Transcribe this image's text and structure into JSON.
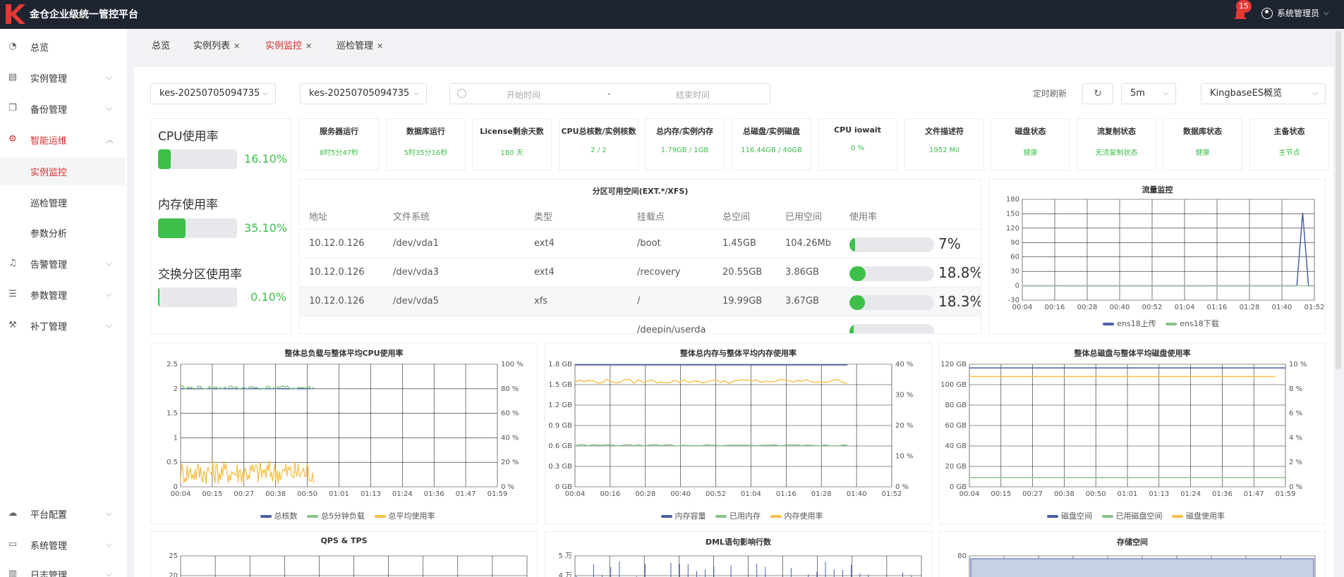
{
  "app": {
    "title": "金仓企业级统一管控平台"
  },
  "header": {
    "notification_count": "15",
    "user": "系统管理员"
  },
  "sidebar": {
    "items": [
      {
        "label": "总览",
        "icon": "dashboard-icon"
      },
      {
        "label": "实例管理",
        "icon": "server-icon"
      },
      {
        "label": "备份管理",
        "icon": "copy-icon"
      },
      {
        "label": "智能运维",
        "icon": "gear-icon"
      },
      {
        "label": "实例监控",
        "icon": ""
      },
      {
        "label": "巡检管理",
        "icon": ""
      },
      {
        "label": "参数分析",
        "icon": ""
      },
      {
        "label": "告警管理",
        "icon": "bell-icon"
      },
      {
        "label": "参数管理",
        "icon": "list-icon"
      },
      {
        "label": "补丁管理",
        "icon": "wrench-icon"
      },
      {
        "label": "平台配置",
        "icon": "cloud-icon"
      },
      {
        "label": "系统管理",
        "icon": "monitor-icon"
      },
      {
        "label": "日志管理",
        "icon": "log-icon"
      }
    ]
  },
  "tabs": [
    {
      "label": "总览"
    },
    {
      "label": "实例列表"
    },
    {
      "label": "实例监控"
    },
    {
      "label": "巡检管理"
    }
  ],
  "filters": {
    "instance1": "kes-20250705094735",
    "instance2": "kes-20250705094735",
    "start_placeholder": "开始时间",
    "sep": "-",
    "end_placeholder": "结束时间",
    "timer_label": "定时刷新",
    "interval": "5m",
    "view": "KingbaseES概览"
  },
  "usage": {
    "cpu": {
      "label": "CPU使用率",
      "value": "16.10%",
      "fraction": 0.161
    },
    "mem": {
      "label": "内存使用率",
      "value": "35.10%",
      "fraction": 0.351
    },
    "swap": {
      "label": "交换分区使用率",
      "value": "0.10%",
      "fraction": 0.001
    }
  },
  "stats": [
    {
      "title": "服务器运行",
      "value": "8时5分47秒"
    },
    {
      "title": "数据库运行",
      "value": "5时35分16秒"
    },
    {
      "title": "License剩余天数",
      "value": "180 天"
    },
    {
      "title": "CPU总核数/实例核数",
      "value": "2 / 2"
    },
    {
      "title": "总内存/实例内存",
      "value": "1.79GB / 1GB"
    },
    {
      "title": "总磁盘/实例磁盘",
      "value": "116.44GB / 40GB"
    },
    {
      "title": "CPU iowait",
      "value": "0 %"
    },
    {
      "title": "文件描述符",
      "value": "1952 MiI"
    },
    {
      "title": "磁盘状态",
      "value": "健康"
    },
    {
      "title": "流复制状态",
      "value": "无流复制状态"
    },
    {
      "title": "数据库状态",
      "value": "健康"
    },
    {
      "title": "主备状态",
      "value": "主节点"
    }
  ],
  "partition": {
    "title": "分区可用空间(EXT.*/XFS)",
    "headers": [
      "地址",
      "文件系统",
      "类型",
      "挂载点",
      "总空间",
      "已用空间",
      "使用率"
    ],
    "rows": [
      {
        "addr": "10.12.0.126",
        "fs": "/dev/vda1",
        "type": "ext4",
        "mount": "/boot",
        "total": "1.45GB",
        "used": "104.26Mb",
        "pct": "7%",
        "fraction": 0.07
      },
      {
        "addr": "10.12.0.126",
        "fs": "/dev/vda3",
        "type": "ext4",
        "mount": "/recovery",
        "total": "20.55GB",
        "used": "3.86GB",
        "pct": "18.8%",
        "fraction": 0.188
      },
      {
        "addr": "10.12.0.126",
        "fs": "/dev/vda5",
        "type": "xfs",
        "mount": "/",
        "total": "19.99GB",
        "used": "3.67GB",
        "pct": "18.3%",
        "fraction": 0.183
      },
      {
        "addr": "",
        "fs": "",
        "type": "",
        "mount": "/deepin/userda",
        "total": "",
        "used": "",
        "pct": "",
        "fraction": 0.02
      }
    ]
  },
  "colors": {
    "accent": "#d32f2f",
    "green": "#3dbf4a",
    "blue": "#4a5fa8",
    "yellow": "#f6c04a",
    "lightgreen": "#8bc48a"
  },
  "chart_data": [
    {
      "type": "line",
      "title": "流量监控",
      "x": [
        "00:04",
        "00:16",
        "00:28",
        "00:40",
        "00:52",
        "01:04",
        "01:16",
        "01:28",
        "01:40",
        "01:52"
      ],
      "ylim": [
        -30,
        180
      ],
      "yticks": [
        -30,
        0,
        30,
        60,
        90,
        120,
        150,
        180
      ],
      "series": [
        {
          "name": "ens18上传",
          "color": "#4a5fa8",
          "points": [
            [
              0,
              0
            ],
            [
              0.94,
              0
            ],
            [
              0.96,
              152
            ],
            [
              0.98,
              0
            ],
            [
              1,
              0
            ]
          ]
        },
        {
          "name": "ens18下载",
          "color": "#8bc48a",
          "points": [
            [
              0,
              0
            ],
            [
              1,
              0
            ]
          ]
        }
      ]
    },
    {
      "type": "line",
      "title": "整体总负载与整体平均CPU使用率",
      "x": [
        "00:04",
        "00:15",
        "00:27",
        "00:38",
        "00:50",
        "01:01",
        "01:13",
        "01:24",
        "01:36",
        "01:47",
        "01:59"
      ],
      "ylim": [
        0,
        2.5
      ],
      "yticks": [
        "0",
        "0.5",
        "1",
        "1.5",
        "2",
        "2.5"
      ],
      "y2ticks": [
        "0 %",
        "20 %",
        "40 %",
        "60 %",
        "80 %",
        "100 %"
      ],
      "series": [
        {
          "name": "总核数",
          "color": "#4a5fa8",
          "start": 0,
          "end": 0.42,
          "value": 2,
          "noise": 0
        },
        {
          "name": "总5分钟负载",
          "color": "#8bc48a",
          "start": 0,
          "end": 0.42,
          "value": 2.02,
          "noise": 0.04
        },
        {
          "name": "总平均使用率",
          "color": "#f6c04a",
          "start": 0,
          "end": 0.42,
          "value": 0.3,
          "noise": 0.25
        }
      ]
    },
    {
      "type": "line",
      "title": "整体总内存与整体平均内存使用率",
      "x": [
        "00:04",
        "00:16",
        "00:28",
        "00:40",
        "00:52",
        "01:04",
        "01:16",
        "01:28",
        "01:40",
        "01:52"
      ],
      "ylim": [
        0,
        1.8
      ],
      "yticks": [
        "0 GB",
        "0.3 GB",
        "0.6 GB",
        "0.9 GB",
        "1.2 GB",
        "1.5 GB",
        "1.8 GB"
      ],
      "y2ticks": [
        "0 %",
        "10 %",
        "20 %",
        "30 %",
        "40 %"
      ],
      "series": [
        {
          "name": "内存容量",
          "color": "#4a5fa8",
          "start": 0,
          "end": 0.86,
          "value": 1.79,
          "noise": 0
        },
        {
          "name": "已用内存",
          "color": "#8bc48a",
          "start": 0,
          "end": 0.86,
          "value": 0.61,
          "noise": 0.01
        },
        {
          "name": "内存使用率",
          "color": "#f6c04a",
          "start": 0,
          "end": 0.86,
          "value": 1.55,
          "noise": 0.03
        }
      ]
    },
    {
      "type": "line",
      "title": "整体总磁盘与整体平均磁盘使用率",
      "x": [
        "00:04",
        "00:15",
        "00:27",
        "00:38",
        "00:50",
        "01:01",
        "01:13",
        "01:24",
        "01:36",
        "01:47",
        "01:59"
      ],
      "ylim": [
        0,
        120
      ],
      "yticks": [
        "0 GB",
        "20 GB",
        "40 GB",
        "60 GB",
        "80 GB",
        "100 GB",
        "120 GB"
      ],
      "y2ticks": [
        "0 %",
        "2 %",
        "4 %",
        "6 %",
        "8 %",
        "10 %"
      ],
      "series": [
        {
          "name": "磁盘空间",
          "color": "#4a5fa8",
          "start": 0,
          "end": 1,
          "value": 116.4,
          "noise": 0
        },
        {
          "name": "已用磁盘空间",
          "color": "#8bc48a",
          "start": 0,
          "end": 1,
          "value": 9,
          "noise": 0
        },
        {
          "name": "磁盘使用率",
          "color": "#f6c04a",
          "start": 0,
          "end": 0.97,
          "value": 108,
          "noise": 0
        }
      ]
    },
    {
      "type": "line",
      "title": "QPS & TPS",
      "yticks": [
        "25",
        "20"
      ]
    },
    {
      "type": "line",
      "title": "DML语句影响行数",
      "yticks": [
        "5 万",
        "4 万"
      ]
    },
    {
      "type": "line",
      "title": "存储空间",
      "yticks": [
        "80"
      ]
    }
  ]
}
